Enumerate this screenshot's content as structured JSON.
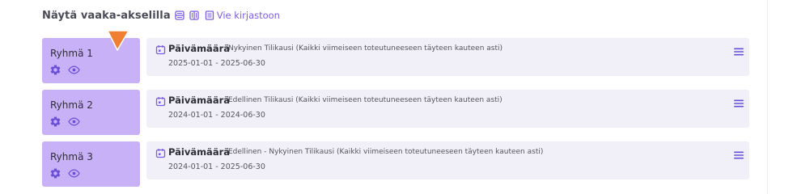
{
  "header": {
    "title": "Näytä vaaka-akselilla",
    "export_label": "Vie kirjastoon",
    "icons": [
      "horizontal-layout-icon",
      "vertical-layout-icon",
      "library-icon"
    ]
  },
  "colors": {
    "accent": "#7c5ce6",
    "group_bg": "#c9b1f7",
    "card_bg": "#f1f0f8",
    "cursor": "#f07f33"
  },
  "groups": [
    {
      "label": "Ryhmä 1",
      "filter": {
        "title": "Päivämäärä",
        "description": "Nykyinen Tilikausi (Kaikki viimeiseen toteutuneeseen täyteen kauteen asti)",
        "range": "2025-01-01 - 2025-06-30"
      }
    },
    {
      "label": "Ryhmä 2",
      "filter": {
        "title": "Päivämäärä",
        "description": "Edellinen Tilikausi (Kaikki viimeiseen toteutuneeseen täyteen kauteen asti)",
        "range": "2024-01-01 - 2024-06-30"
      }
    },
    {
      "label": "Ryhmä 3",
      "filter": {
        "title": "Päivämäärä",
        "description": "Edellinen - Nykyinen Tilikausi (Kaikki viimeiseen toteutuneeseen täyteen kauteen asti)",
        "range": "2024-01-01 - 2025-06-30"
      }
    }
  ]
}
